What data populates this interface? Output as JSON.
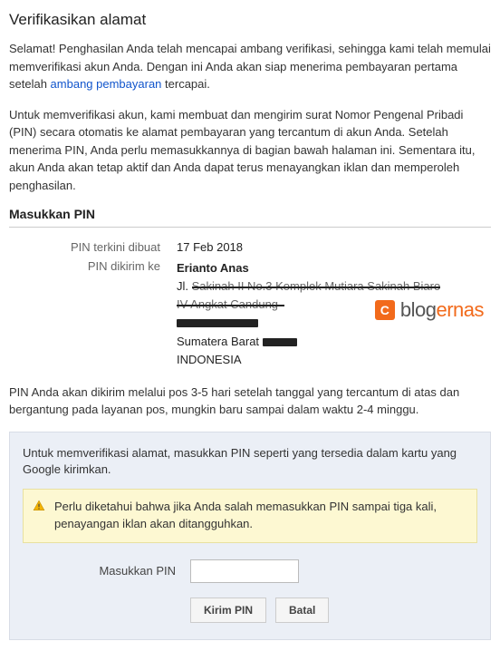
{
  "page": {
    "title": "Verifikasikan alamat"
  },
  "intro": {
    "p1_part1": "Selamat! Penghasilan Anda telah mencapai ambang verifikasi, sehingga kami telah memulai memverifikasi akun Anda. Dengan ini Anda akan siap menerima pembayaran pertama setelah ",
    "link_text": "ambang pembayaran",
    "p1_part2": " tercapai.",
    "p2": "Untuk memverifikasi akun, kami membuat dan mengirim surat Nomor Pengenal Pribadi (PIN) secara otomatis ke alamat pembayaran yang tercantum di akun Anda. Setelah menerima PIN, Anda perlu memasukkannya di bagian    bawah halaman ini. Sementara itu, akun Anda akan tetap aktif dan Anda dapat terus menayangkan iklan dan memperoleh penghasilan."
  },
  "section": {
    "title": "Masukkan PIN"
  },
  "pin_info": {
    "date_label": "PIN terkini dibuat",
    "date_value": "17 Feb 2018",
    "recipient_label": "PIN dikirim ke",
    "recipient_name": "Erianto Anas",
    "addr_prefix": "Jl. ",
    "province_prefix": "Sumatera Barat ",
    "country": "INDONESIA"
  },
  "watermark": {
    "badge": "C",
    "text1": "blog",
    "text2": "ernas"
  },
  "note": "PIN Anda akan dikirim melalui pos 3-5 hari setelah tanggal yang tercantum di atas dan bergantung pada layanan pos, mungkin baru sampai dalam waktu 2-4 minggu.",
  "verify": {
    "lead": "Untuk memverifikasi alamat, masukkan PIN seperti yang tersedia dalam kartu yang Google kirimkan.",
    "warning": "Perlu diketahui bahwa jika Anda salah memasukkan PIN sampai tiga kali, penayangan iklan akan ditangguhkan.",
    "input_label": "Masukkan PIN",
    "submit_label": "Kirim PIN",
    "cancel_label": "Batal"
  }
}
